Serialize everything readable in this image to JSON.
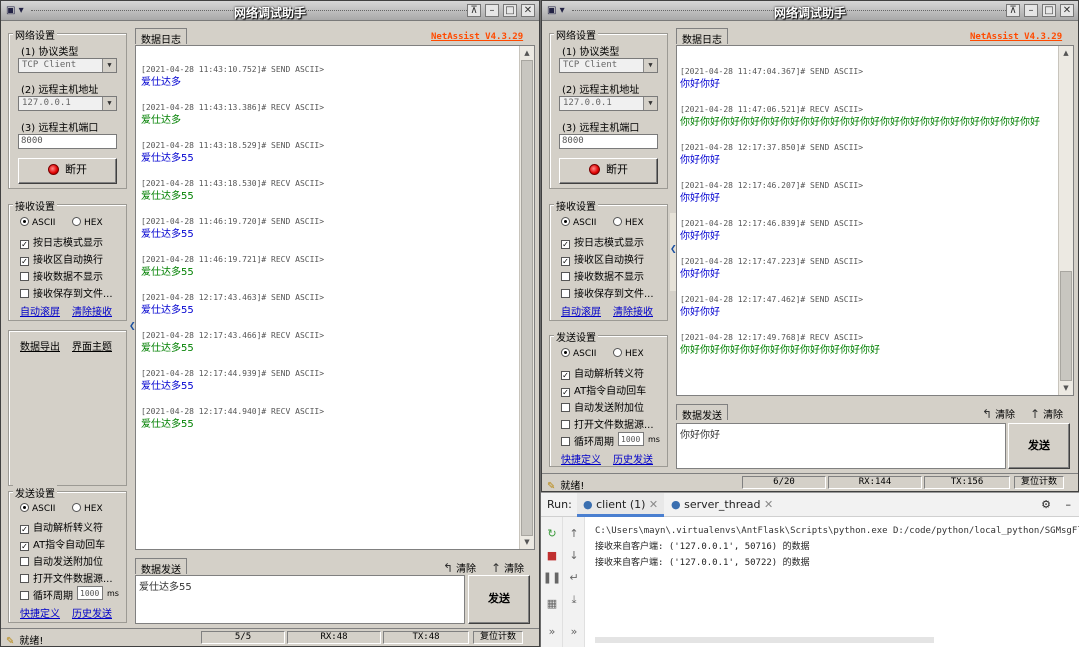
{
  "colors": {
    "send": "#0000d0",
    "recv": "#008000",
    "brand": "#ff4a00",
    "link": "#0000c8"
  },
  "left": {
    "title": "网络调试助手",
    "brand": "NetAssist V4.3.29",
    "net": {
      "group_label": "网络设置",
      "protocol_label": "(1) 协议类型",
      "protocol_value": "TCP Client",
      "host_label": "(2) 远程主机地址",
      "host_value": "127.0.0.1",
      "port_label": "(3) 远程主机端口",
      "port_value": "8000",
      "connect_label": "断开"
    },
    "recv_settings": {
      "group_label": "接收设置",
      "radio_ascii": "ASCII",
      "radio_hex": "HEX",
      "opt1": "按日志模式显示",
      "opt2": "接收区自动换行",
      "opt3": "接收数据不显示",
      "opt4": "接收保存到文件...",
      "link1": "自动滚屏",
      "link2": "清除接收"
    },
    "extra_links": {
      "export": "数据导出",
      "theme": "界面主题"
    },
    "send_settings": {
      "group_label": "发送设置",
      "radio_ascii": "ASCII",
      "radio_hex": "HEX",
      "opt1": "自动解析转义符",
      "opt2": "AT指令自动回车",
      "opt3": "自动发送附加位",
      "opt4": "打开文件数据源...",
      "opt5": "循环周期",
      "period_value": "1000",
      "period_unit": "ms",
      "link1": "快捷定义",
      "link2": "历史发送"
    },
    "log_tab": "数据日志",
    "log": [
      {
        "hdr": "[2021-04-28 11:43:10.752]# SEND ASCII>",
        "body": "爱仕达多",
        "type": "send"
      },
      {
        "hdr": "[2021-04-28 11:43:13.386]# RECV ASCII>",
        "body": "爱仕达多",
        "type": "recv"
      },
      {
        "hdr": "[2021-04-28 11:43:18.529]# SEND ASCII>",
        "body": "爱仕达多55",
        "type": "send"
      },
      {
        "hdr": "[2021-04-28 11:43:18.530]# RECV ASCII>",
        "body": "爱仕达多55",
        "type": "recv"
      },
      {
        "hdr": "[2021-04-28 11:46:19.720]# SEND ASCII>",
        "body": "爱仕达多55",
        "type": "send"
      },
      {
        "hdr": "[2021-04-28 11:46:19.721]# RECV ASCII>",
        "body": "爱仕达多55",
        "type": "recv"
      },
      {
        "hdr": "[2021-04-28 12:17:43.463]# SEND ASCII>",
        "body": "爱仕达多55",
        "type": "send"
      },
      {
        "hdr": "[2021-04-28 12:17:43.466]# RECV ASCII>",
        "body": "爱仕达多55",
        "type": "recv"
      },
      {
        "hdr": "[2021-04-28 12:17:44.939]# SEND ASCII>",
        "body": "爱仕达多55",
        "type": "send"
      },
      {
        "hdr": "[2021-04-28 12:17:44.940]# RECV ASCII>",
        "body": "爱仕达多55",
        "type": "recv"
      }
    ],
    "send_tab": "数据发送",
    "clear1": "清除",
    "clear2": "清除",
    "send_text": "爱仕达多55",
    "send_button": "发送",
    "status": {
      "ready": "就绪!",
      "count": "5/5",
      "rx": "RX:48",
      "tx": "TX:48",
      "reset": "复位计数"
    }
  },
  "right": {
    "title": "网络调试助手",
    "brand": "NetAssist V4.3.29",
    "net": {
      "group_label": "网络设置",
      "protocol_label": "(1) 协议类型",
      "protocol_value": "TCP Client",
      "host_label": "(2) 远程主机地址",
      "host_value": "127.0.0.1",
      "port_label": "(3) 远程主机端口",
      "port_value": "8000",
      "connect_label": "断开"
    },
    "recv_settings": {
      "group_label": "接收设置",
      "radio_ascii": "ASCII",
      "radio_hex": "HEX",
      "opt1": "按日志模式显示",
      "opt2": "接收区自动换行",
      "opt3": "接收数据不显示",
      "opt4": "接收保存到文件...",
      "link1": "自动滚屏",
      "link2": "清除接收"
    },
    "send_settings": {
      "group_label": "发送设置",
      "radio_ascii": "ASCII",
      "radio_hex": "HEX",
      "opt1": "自动解析转义符",
      "opt2": "AT指令自动回车",
      "opt3": "自动发送附加位",
      "opt4": "打开文件数据源...",
      "opt5": "循环周期",
      "period_value": "1000",
      "period_unit": "ms",
      "link1": "快捷定义",
      "link2": "历史发送"
    },
    "log_tab": "数据日志",
    "log": [
      {
        "hdr": "[2021-04-28 11:47:04.367]# SEND ASCII>",
        "body": "你好你好",
        "type": "send"
      },
      {
        "hdr": "[2021-04-28 11:47:06.521]# RECV ASCII>",
        "body": "你好你好你好你好你好你好你好你好你好你好你好你好你好你好你好你好你好你好",
        "type": "recv"
      },
      {
        "hdr": "[2021-04-28 12:17:37.850]# SEND ASCII>",
        "body": "你好你好",
        "type": "send"
      },
      {
        "hdr": "[2021-04-28 12:17:46.207]# SEND ASCII>",
        "body": "你好你好",
        "type": "send"
      },
      {
        "hdr": "[2021-04-28 12:17:46.839]# SEND ASCII>",
        "body": "你好你好",
        "type": "send"
      },
      {
        "hdr": "[2021-04-28 12:17:47.223]# SEND ASCII>",
        "body": "你好你好",
        "type": "send"
      },
      {
        "hdr": "[2021-04-28 12:17:47.462]# SEND ASCII>",
        "body": "你好你好",
        "type": "send"
      },
      {
        "hdr": "[2021-04-28 12:17:49.768]# RECV ASCII>",
        "body": "你好你好你好你好你好你好你好你好你好你好",
        "type": "recv"
      }
    ],
    "send_tab": "数据发送",
    "clear1": "清除",
    "clear2": "清除",
    "send_text": "你好你好",
    "send_button": "发送",
    "status": {
      "ready": "就绪!",
      "count": "6/20",
      "rx": "RX:144",
      "tx": "TX:156",
      "reset": "复位计数"
    }
  },
  "run": {
    "label": "Run:",
    "tab1": "client (1)",
    "tab2": "server_thread",
    "lines": [
      "C:\\Users\\mayn\\.virtualenvs\\AntFlask\\Scripts\\python.exe D:/code/python/local_python/SGMsgFlask/j",
      "接收来自客户端: ('127.0.0.1', 50716) 的数据",
      "接收来自客户端: ('127.0.0.1', 50722) 的数据"
    ]
  }
}
